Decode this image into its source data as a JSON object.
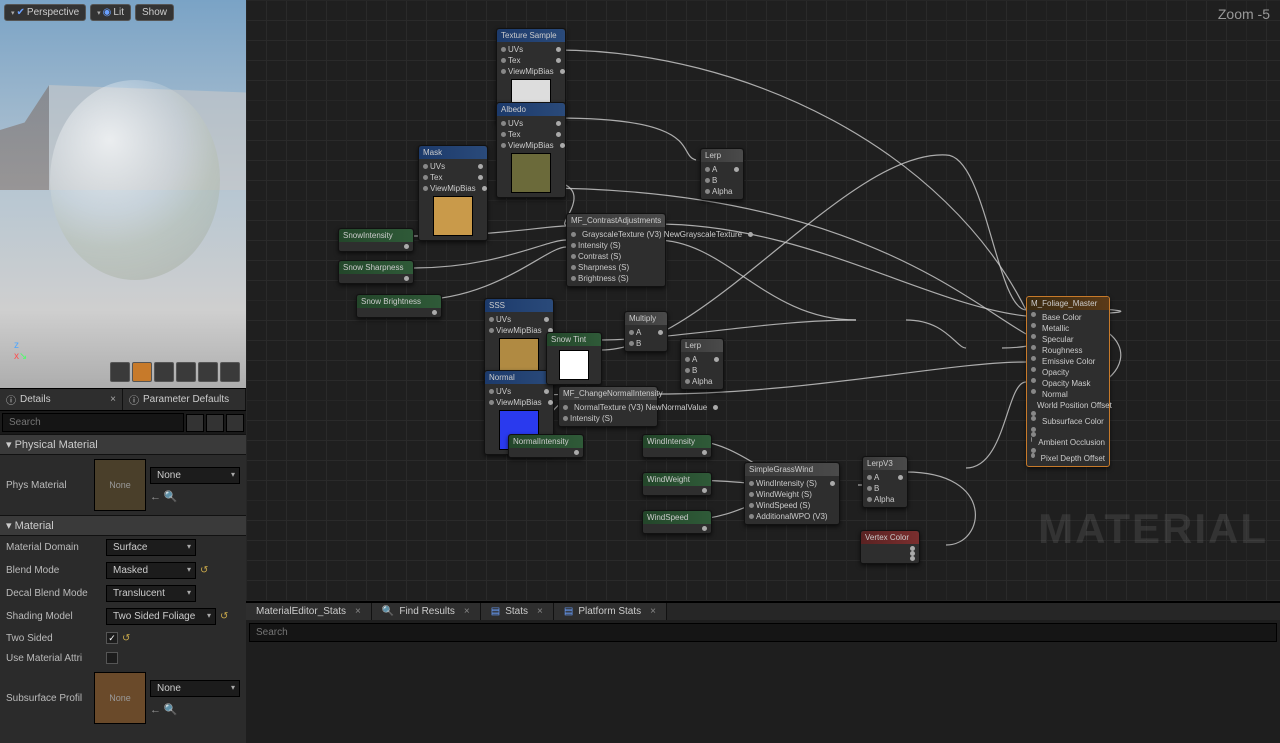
{
  "viewport": {
    "perspective": "Perspective",
    "lit": "Lit",
    "show": "Show"
  },
  "zoom_label": "Zoom -5",
  "watermark": "MATERIAL",
  "panelTabs": {
    "details": "Details",
    "paramDefaults": "Parameter Defaults"
  },
  "search_placeholder": "Search",
  "sections": {
    "physMat": "Physical Material",
    "material": "Material"
  },
  "props": {
    "physMat_label": "Phys Material",
    "physMat_value": "None",
    "swatch_none": "None",
    "matDomain_label": "Material Domain",
    "matDomain_value": "Surface",
    "blendMode_label": "Blend Mode",
    "blendMode_value": "Masked",
    "decalBlend_label": "Decal Blend Mode",
    "decalBlend_value": "Translucent",
    "shading_label": "Shading Model",
    "shading_value": "Two Sided Foliage",
    "twoSided_label": "Two Sided",
    "useAttr_label": "Use Material Attri",
    "subsurf_label": "Subsurface Profil",
    "subsurf_value": "None"
  },
  "bottomTabs": {
    "stats1": "MaterialEditor_Stats",
    "find": "Find Results",
    "stats2": "Stats",
    "platform": "Platform Stats"
  },
  "bottom_search_placeholder": "Search",
  "nodes": {
    "texSample": {
      "title": "Texture Sample",
      "in": [
        "UVs",
        "Tex",
        "ViewMipBias"
      ],
      "thumb": "#ddd"
    },
    "albedo": {
      "title": "Albedo",
      "in": [
        "UVs",
        "Tex",
        "ViewMipBias"
      ],
      "thumb": "#6b6a3a"
    },
    "mask": {
      "title": "Mask",
      "in": [
        "UVs",
        "Tex",
        "ViewMipBias"
      ],
      "thumb": "#c99a4a"
    },
    "snowIntensity": {
      "title": "SnowIntensity"
    },
    "snowSharpness": {
      "title": "Snow Sharpness"
    },
    "snowBrightness": {
      "title": "Snow Brightness"
    },
    "contrast": {
      "title": "MF_ContrastAdjustments",
      "rows": [
        "GrayscaleTexture (V3)  NewGrayscaleTexture",
        "Intensity (S)",
        "Contrast (S)",
        "Sharpness (S)",
        "Brightness (S)"
      ]
    },
    "sss": {
      "title": "SSS",
      "in": [
        "UVs",
        "ViewMipBias"
      ],
      "thumb": "#b08a42"
    },
    "normal": {
      "title": "Normal",
      "in": [
        "UVs",
        "ViewMipBias"
      ],
      "thumb": "#2a3aee"
    },
    "snowTint": {
      "title": "Snow Tint",
      "thumb": "#ffffff"
    },
    "normalIntensity": {
      "title": "NormalIntensity"
    },
    "changeNormal": {
      "title": "MF_ChangeNormalIntensity",
      "rows": [
        "NormalTexture (V3)  NewNormalValue",
        "Intensity (S)"
      ]
    },
    "multiply": {
      "title": "Multiply",
      "rows": [
        "A",
        "B"
      ]
    },
    "lerp1": {
      "title": "Lerp",
      "rows": [
        "A",
        "B",
        "Alpha"
      ]
    },
    "lerp2": {
      "title": "Lerp",
      "rows": [
        "A",
        "B",
        "Alpha"
      ]
    },
    "lerp3": {
      "title": "LerpV3",
      "rows": [
        "A",
        "B",
        "Alpha"
      ]
    },
    "windIntensity": {
      "title": "WindIntensity"
    },
    "windWeight": {
      "title": "WindWeight"
    },
    "windSpeed": {
      "title": "WindSpeed"
    },
    "simpleWind": {
      "title": "SimpleGrassWind",
      "rows": [
        "WindIntensity (S)",
        "WindWeight (S)",
        "WindSpeed (S)",
        "AdditionalWPO (V3)"
      ]
    },
    "vertexColor": {
      "title": "Vertex Color"
    },
    "output": {
      "title": "M_Foliage_Master",
      "pins": [
        "Base Color",
        "Metallic",
        "Specular",
        "Roughness",
        "Emissive Color",
        "Opacity",
        "Opacity Mask",
        "Normal",
        "World Position Offset",
        "",
        "Subsurface Color",
        "",
        "",
        "Ambient Occlusion",
        "",
        "Pixel Depth Offset"
      ]
    }
  }
}
